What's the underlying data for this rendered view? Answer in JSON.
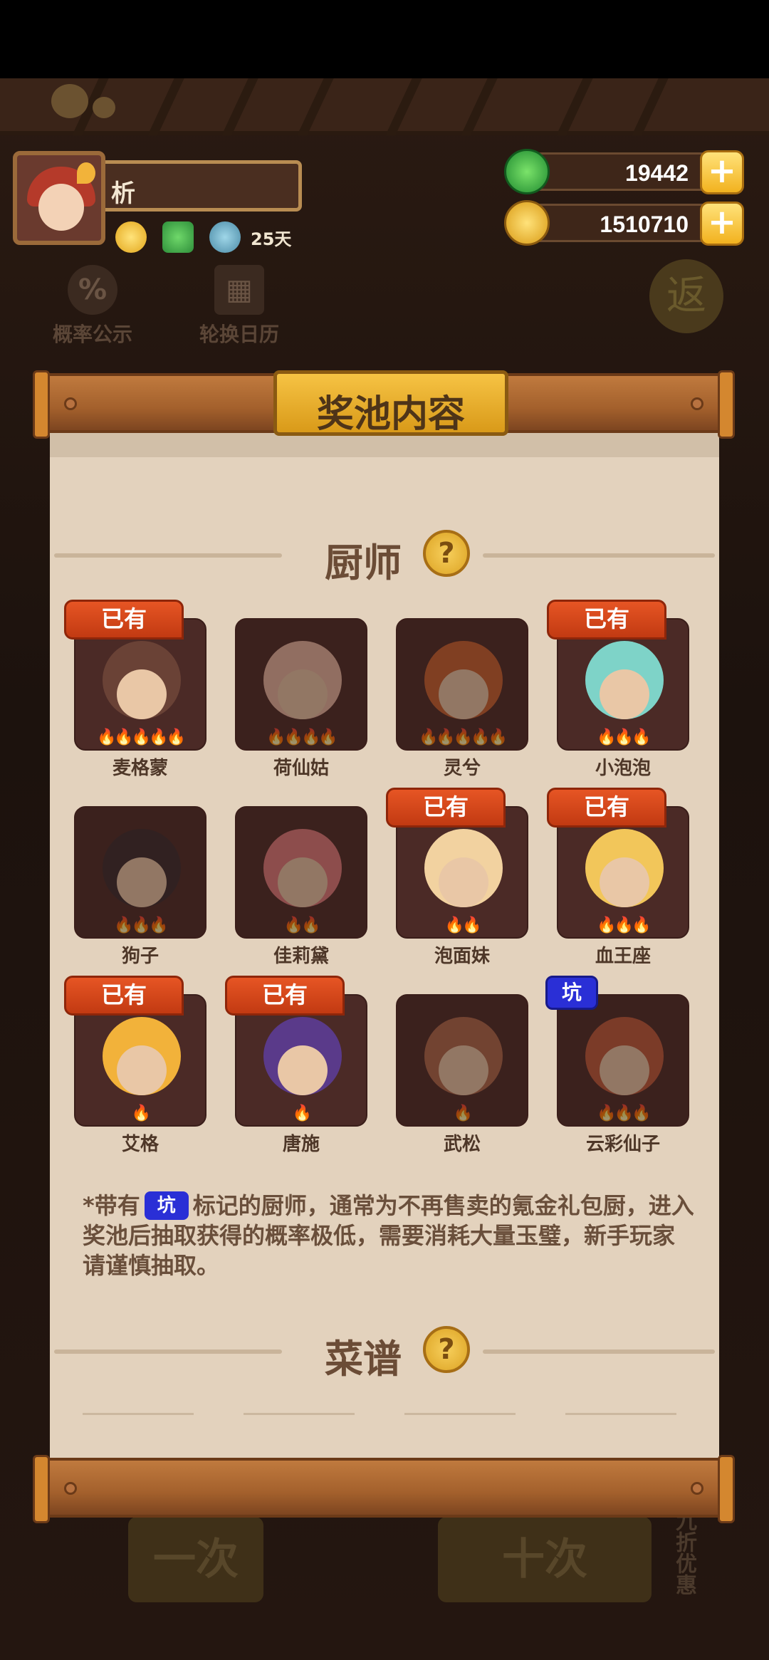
{
  "player": {
    "name": "析",
    "days": "25天"
  },
  "currency": {
    "jade": "19442",
    "gold": "1510710"
  },
  "background": {
    "probability_label": "概率公示",
    "calendar_label": "轮换日历",
    "return_label": "返",
    "draw_one": "一次",
    "draw_ten": "十次",
    "side_offer": "九折优惠"
  },
  "panel": {
    "title": "奖池内容",
    "chef_section": "厨师",
    "recipe_section": "菜谱",
    "owned_badge": "已有",
    "pit_badge": "坑",
    "note_prefix": "*带有",
    "note_body": "标记的厨师，通常为不再售卖的氪金礼包厨，进入奖池后抽取获得的概率极低，需要消耗大量玉璧，新手玩家请谨慎抽取。"
  },
  "chefs": [
    {
      "name": "麦格蒙",
      "owned": true,
      "pit": false,
      "stars": 5,
      "color": "#6a4236"
    },
    {
      "name": "荷仙姑",
      "owned": false,
      "pit": false,
      "stars": 4,
      "color": "#e8b6a0"
    },
    {
      "name": "灵兮",
      "owned": false,
      "pit": false,
      "stars": 5,
      "color": "#c8622e"
    },
    {
      "name": "小泡泡",
      "owned": true,
      "pit": false,
      "stars": 3,
      "color": "#7ed3c8"
    },
    {
      "name": "狗子",
      "owned": false,
      "pit": false,
      "stars": 3,
      "color": "#3a2b2c"
    },
    {
      "name": "佳莉黛",
      "owned": false,
      "pit": false,
      "stars": 2,
      "color": "#e07a7a"
    },
    {
      "name": "泡面妹",
      "owned": true,
      "pit": false,
      "stars": 2,
      "color": "#f2d2a0"
    },
    {
      "name": "血王座",
      "owned": true,
      "pit": false,
      "stars": 3,
      "color": "#f2c65a"
    },
    {
      "name": "艾格",
      "owned": true,
      "pit": false,
      "stars": 1,
      "color": "#f2b23a"
    },
    {
      "name": "唐施",
      "owned": true,
      "pit": false,
      "stars": 1,
      "color": "#5a3a8a"
    },
    {
      "name": "武松",
      "owned": false,
      "pit": false,
      "stars": 1,
      "color": "#b0684a"
    },
    {
      "name": "云彩仙子",
      "owned": false,
      "pit": true,
      "stars": 3,
      "color": "#c05a3a"
    }
  ]
}
